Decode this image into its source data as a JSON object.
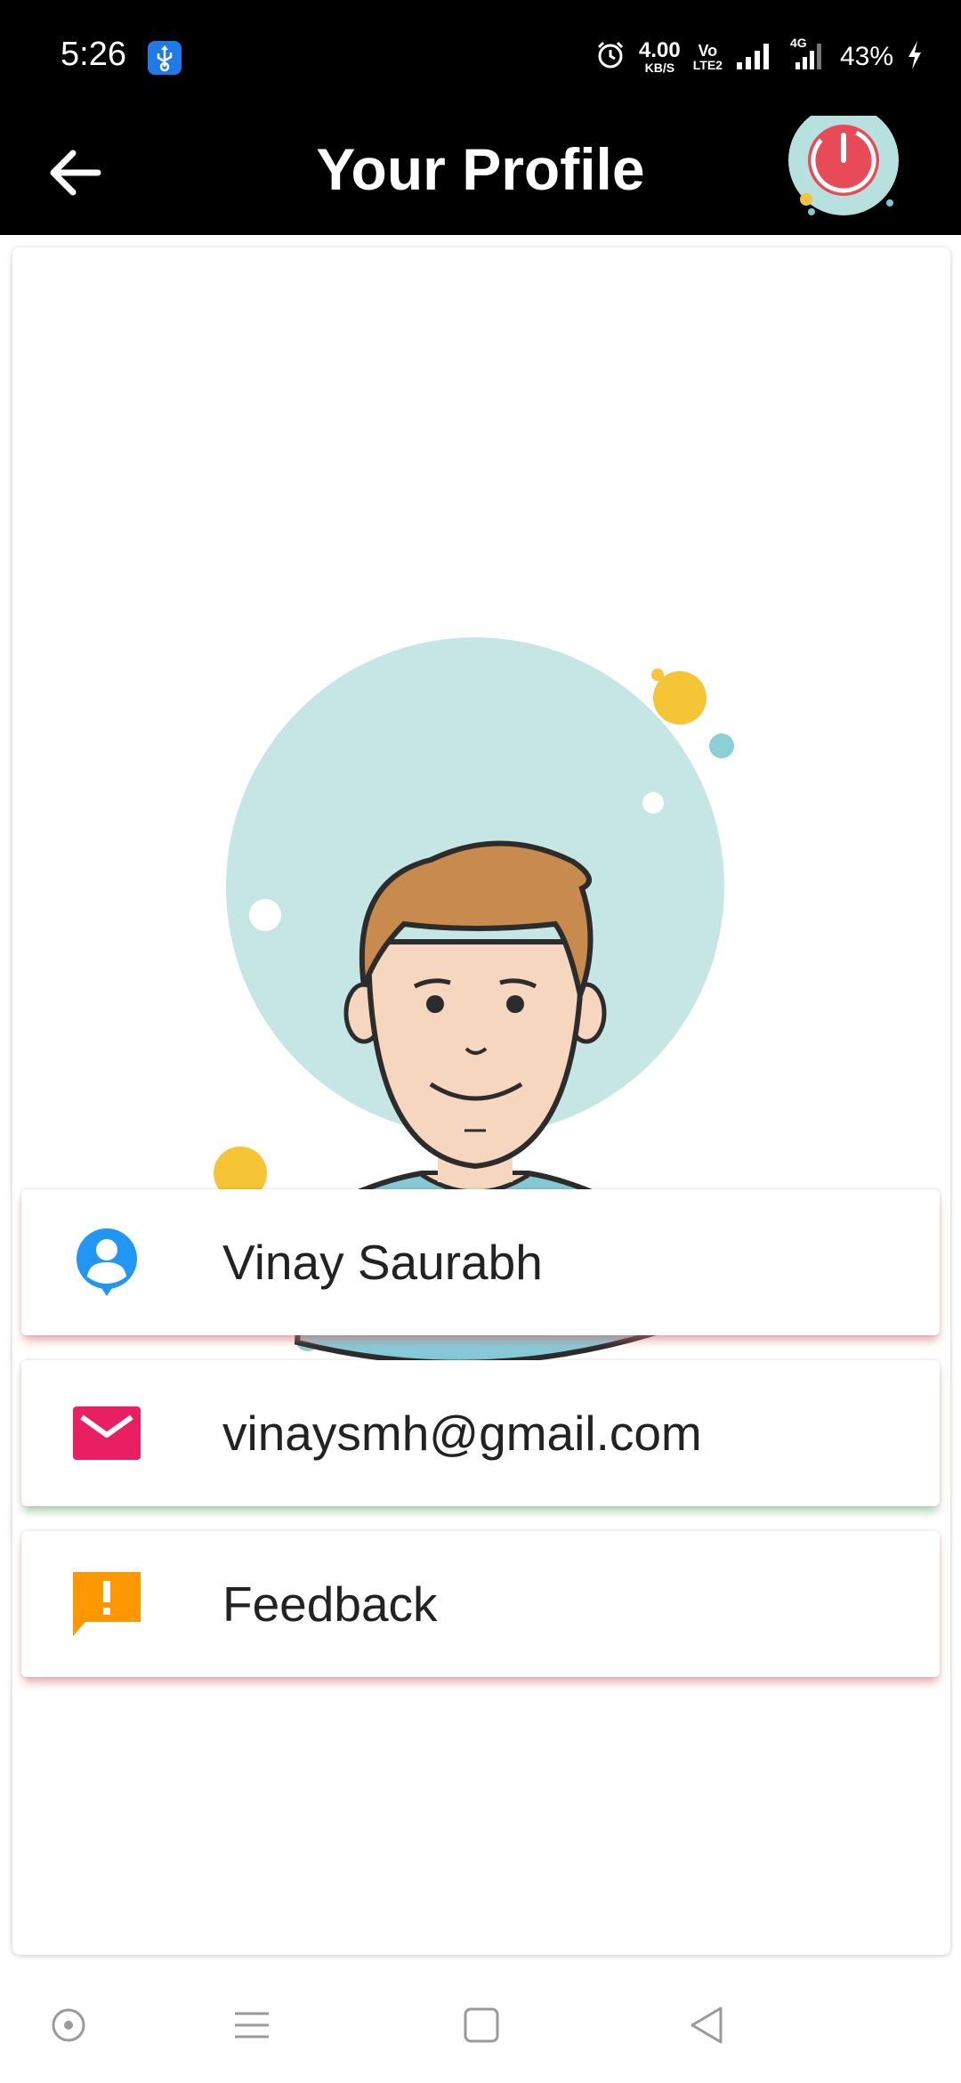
{
  "status_bar": {
    "time": "5:26",
    "speed_value": "4.00",
    "speed_unit": "KB/S",
    "volte_top": "Vo",
    "volte_bottom": "LTE2",
    "network": "4G",
    "battery": "43%"
  },
  "app_bar": {
    "title": "Your Profile"
  },
  "profile": {
    "name": "Vinay Saurabh",
    "email": "vinaysmh@gmail.com",
    "feedback_label": "Feedback"
  },
  "colors": {
    "name_icon": "#2196f3",
    "email_icon": "#e91e63",
    "feedback_icon": "#ff9800",
    "power_ring": "#b7e1df",
    "power_button": "#e84b57"
  }
}
